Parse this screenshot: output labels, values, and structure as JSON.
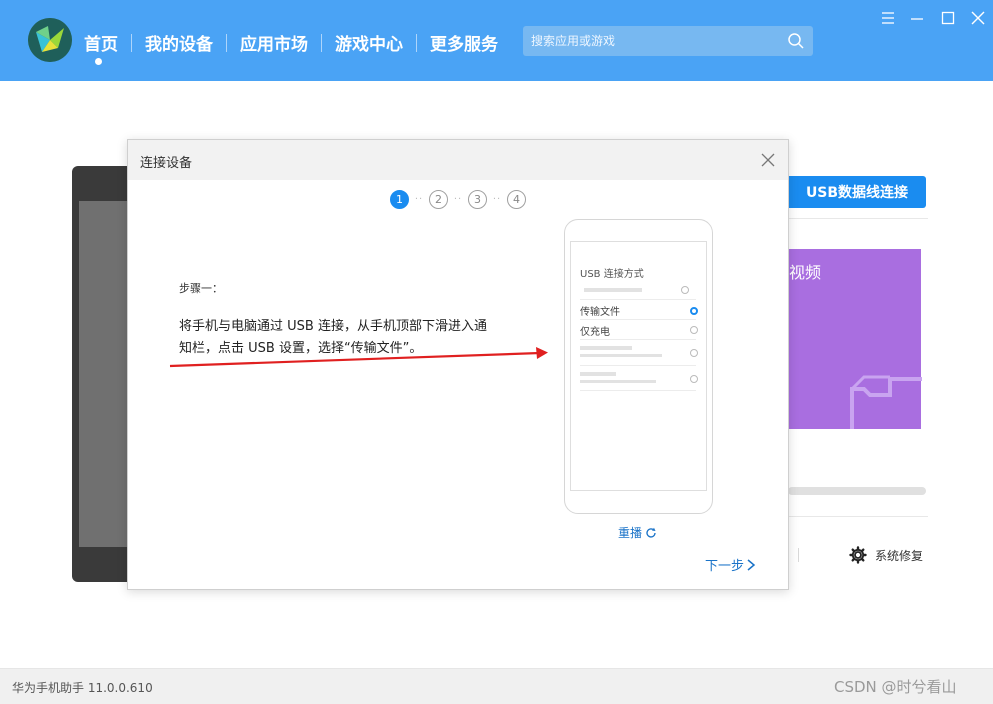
{
  "header": {
    "nav": [
      {
        "label": "首页",
        "active": true
      },
      {
        "label": "我的设备"
      },
      {
        "label": "应用市场"
      },
      {
        "label": "游戏中心"
      },
      {
        "label": "更多服务"
      }
    ],
    "search": {
      "placeholder": "搜索应用或游戏",
      "icon": "search-icon"
    },
    "window_controls": [
      "menu-icon",
      "minimize-icon",
      "maximize-icon",
      "close-icon"
    ],
    "bg_color": "#4aa3f5"
  },
  "background": {
    "usb_button": "USB数据线连接",
    "purple_card_text": "视频",
    "system_repair": "系统修复"
  },
  "dialog": {
    "title": "连接设备",
    "steps": [
      "1",
      "2",
      "3",
      "4"
    ],
    "active_step": 1,
    "step_heading": "步骤一：",
    "step_desc": "将手机与电脑通过 USB 连接，从手机顶部下滑进入通知栏，点击 USB 设置，选择“传输文件”。",
    "phone_mock": {
      "title": "USB 连接方式",
      "options": [
        {
          "label": "传输文件",
          "selected": true
        },
        {
          "label": "仅充电",
          "selected": false
        }
      ]
    },
    "replay": "重播",
    "next": "下一步"
  },
  "statusbar": {
    "version": "华为手机助手 11.0.0.610",
    "watermark": "CSDN @时兮看山"
  }
}
